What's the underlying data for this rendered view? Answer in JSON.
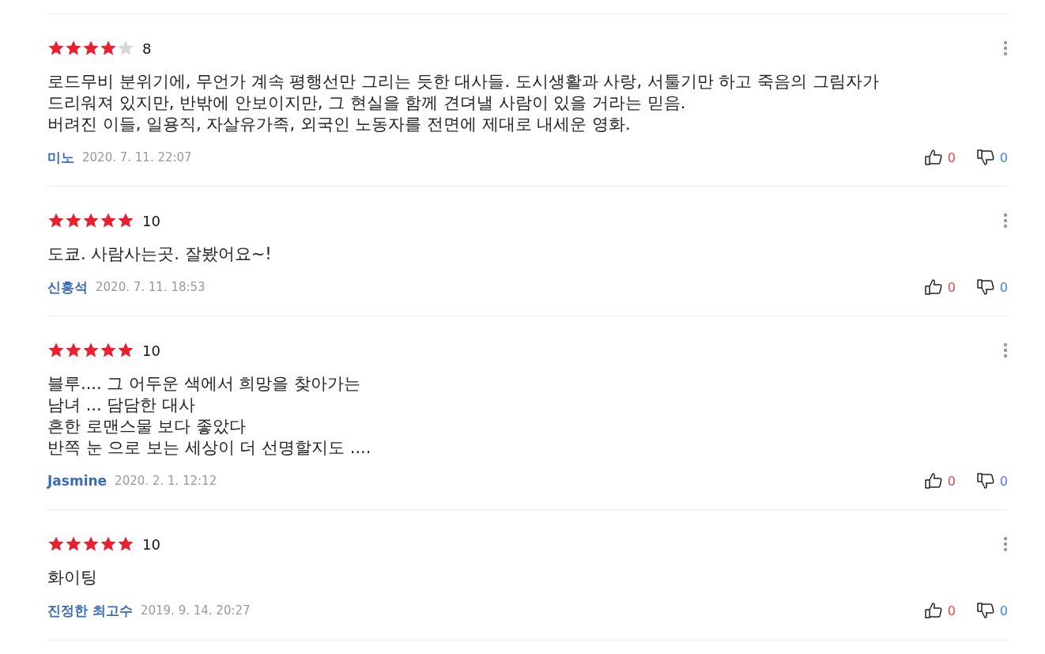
{
  "reviews": [
    {
      "stars": 4,
      "score": "8",
      "text": "로드무비 분위기에, 무언가 계속 평행선만 그리는 듯한 대사들. 도시생활과 사랑, 서툴기만 하고 죽음의 그림자가\n드리워져 있지만, 반밖에 안보이지만, 그 현실을 함께 견뎌낼 사람이 있을 거라는 믿음.\n버려진 이들, 일용직, 자살유가족, 외국인 노동자를 전면에 제대로 내세운 영화.",
      "author": "미노",
      "date": "2020. 7. 11. 22:07",
      "likes": "0",
      "dislikes": "0"
    },
    {
      "stars": 5,
      "score": "10",
      "text": "도쿄. 사람사는곳. 잘봤어요~!",
      "author": "신홍석",
      "date": "2020. 7. 11. 18:53",
      "likes": "0",
      "dislikes": "0"
    },
    {
      "stars": 5,
      "score": "10",
      "text": "블루.... 그 어두운 색에서 희망을 찾아가는\n남녀 ... 담담한 대사\n흔한 로맨스물 보다 좋았다\n반쪽 눈 으로 보는 세상이 더 선명할지도 ....",
      "author": "Jasmine",
      "date": "2020. 2. 1. 12:12",
      "likes": "0",
      "dislikes": "0"
    },
    {
      "stars": 5,
      "score": "10",
      "text": "화이팅",
      "author": "진정한 최고수",
      "date": "2019. 9. 14. 20:27",
      "likes": "0",
      "dislikes": "0"
    }
  ]
}
